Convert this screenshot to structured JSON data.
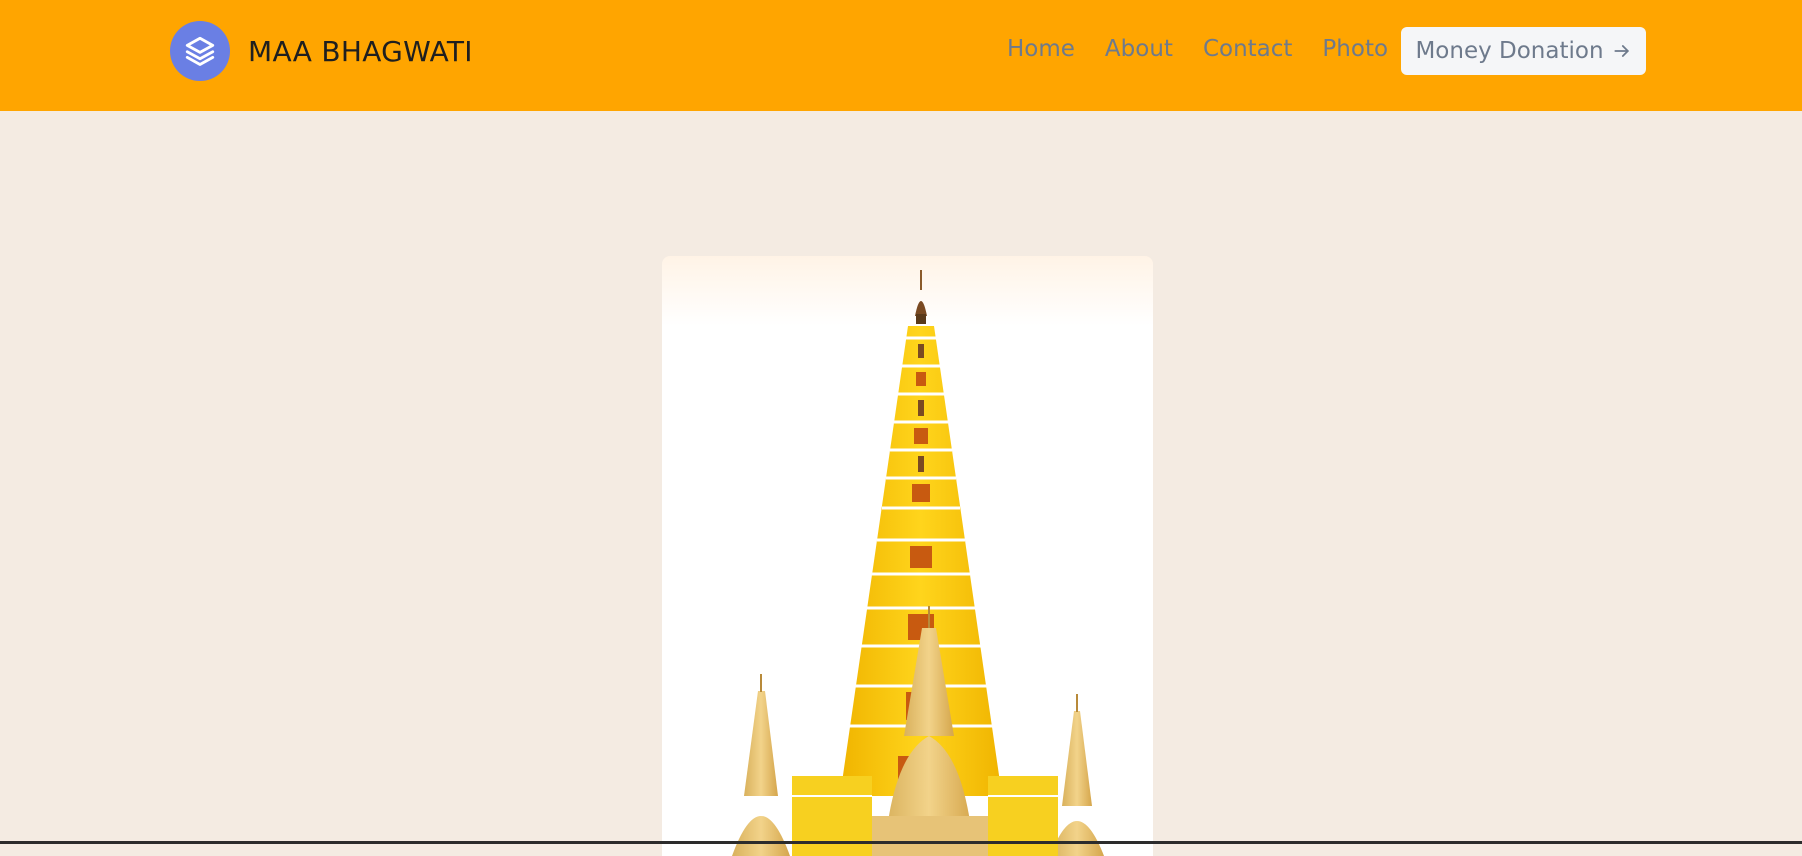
{
  "header": {
    "brand": "MAA BHAGWATI",
    "logo_icon": "layers-icon",
    "bg_color": "#ffa500",
    "nav": [
      {
        "label": "Home"
      },
      {
        "label": "About"
      },
      {
        "label": "Contact"
      },
      {
        "label": "Photo"
      }
    ],
    "cta": {
      "label": "Money Donation",
      "icon": "arrow-right-icon"
    }
  },
  "hero": {
    "image": "temple-tower-image"
  }
}
